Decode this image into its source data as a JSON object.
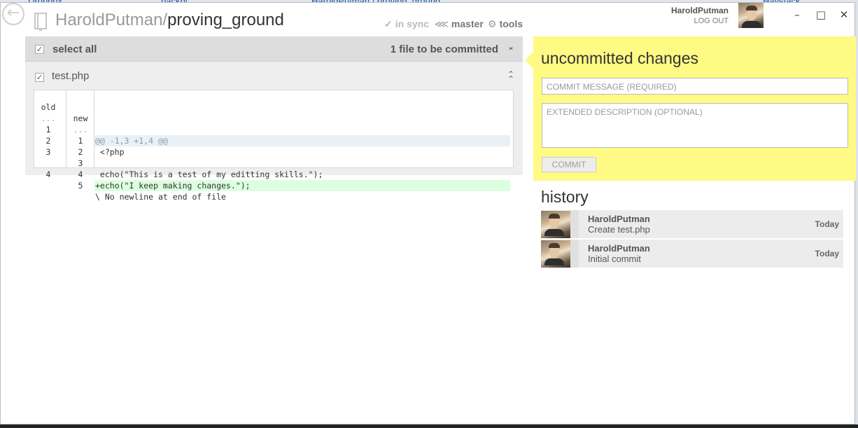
{
  "background_app": {
    "items": [
      "Dropbox",
      "backbi",
      "HaroldPutman / proving_ground",
      "Haystack"
    ]
  },
  "header": {
    "owner": "HaroldPutman/",
    "repo": "proving_ground",
    "sync_label": "in sync",
    "branch_label": "master",
    "tools_label": "tools"
  },
  "user": {
    "name": "HaroldPutman",
    "logout_label": "LOG OUT"
  },
  "window_controls": {
    "minimize": "–",
    "maximize": "□",
    "close": "✕"
  },
  "changes": {
    "select_all_label": "select all",
    "files_to_commit": "1 file to be committed",
    "file": {
      "name": "test.php",
      "col_old": "old",
      "col_new": "new",
      "rows": [
        {
          "type": "hunk",
          "old": "...",
          "new": "...",
          "code": "@@ -1,3 +1,4 @@"
        },
        {
          "type": "ctx",
          "old": "1",
          "new": "1",
          "code": " <?php"
        },
        {
          "type": "ctx",
          "old": "2",
          "new": "2",
          "code": ""
        },
        {
          "type": "ctx",
          "old": "3",
          "new": "3",
          "code": " echo(\"This is a test of my editting skills.\");"
        },
        {
          "type": "add",
          "old": "",
          "new": "4",
          "code": "+echo(\"I keep making changes.\");"
        },
        {
          "type": "ctx",
          "old": "4",
          "new": "5",
          "code": "\\ No newline at end of file"
        }
      ]
    }
  },
  "commit_panel": {
    "title": "uncommitted changes",
    "message_placeholder": "COMMIT MESSAGE (REQUIRED)",
    "description_placeholder": "EXTENDED DESCRIPTION (OPTIONAL)",
    "commit_label": "COMMIT"
  },
  "history": {
    "title": "history",
    "items": [
      {
        "author": "HaroldPutman",
        "message": "Create test.php",
        "when": "Today"
      },
      {
        "author": "HaroldPutman",
        "message": "Initial commit",
        "when": "Today"
      }
    ]
  },
  "colors": {
    "commit_panel_bg": "#fffa83",
    "added_line_bg": "#dcffdf",
    "hunk_bg": "#e9f1f7"
  }
}
